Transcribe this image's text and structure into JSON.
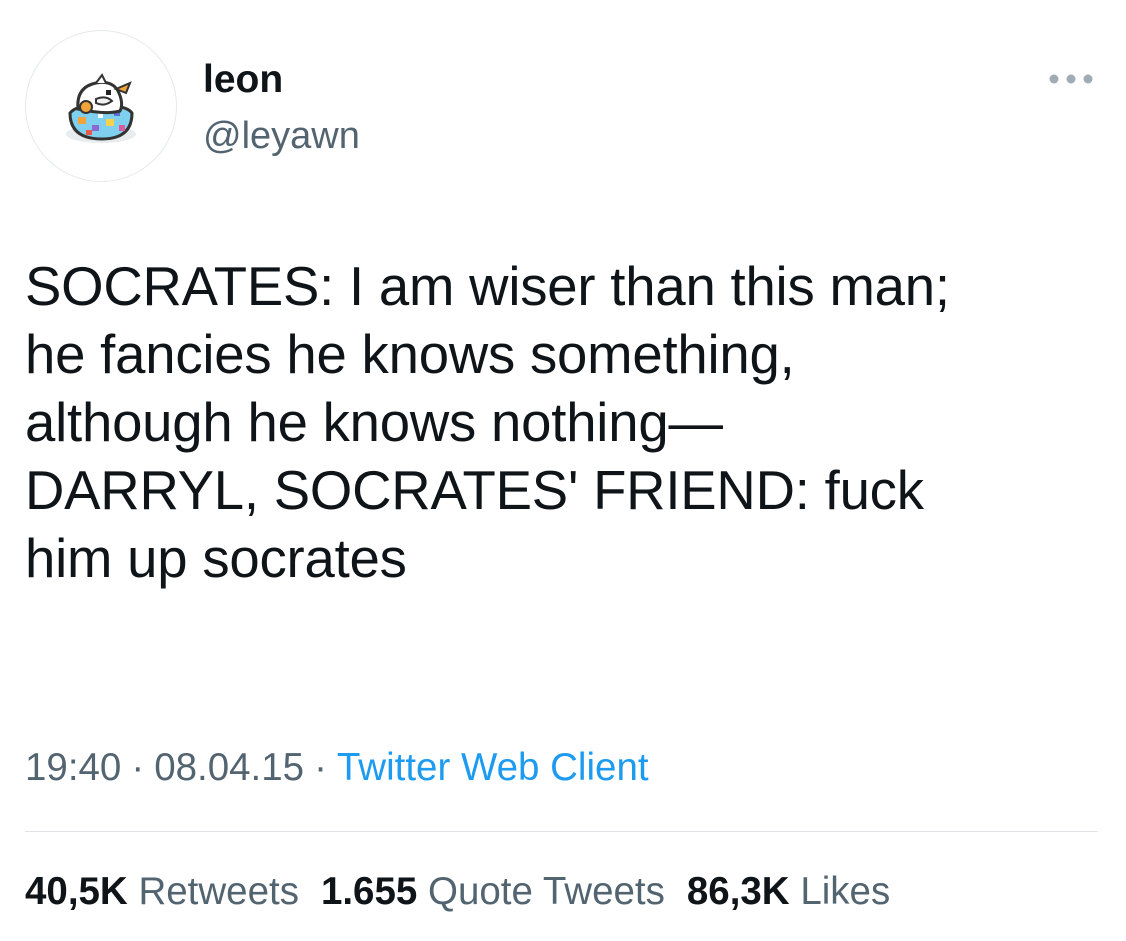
{
  "author": {
    "display_name": "leon",
    "handle": "@leyawn",
    "avatar_icon": "pixel-bird-egg-avatar-icon"
  },
  "more_icon": "more-options-icon",
  "tweet": {
    "text": "SOCRATES: I am wiser than this man;\nhe fancies he knows something,\nalthough he knows nothing—\nDARRYL, SOCRATES' FRIEND: fuck\nhim up socrates"
  },
  "meta": {
    "time": "19:40",
    "separator": "·",
    "date": "08.04.15",
    "source": "Twitter Web Client"
  },
  "stats": {
    "retweets_count": "40,5K",
    "retweets_label": "Retweets",
    "quotes_count": "1.655",
    "quotes_label": "Quote Tweets",
    "likes_count": "86,3K",
    "likes_label": "Likes"
  },
  "colors": {
    "text": "#0f1419",
    "secondary": "#536471",
    "link": "#1d9bf0",
    "divider": "#dfe3e6"
  }
}
